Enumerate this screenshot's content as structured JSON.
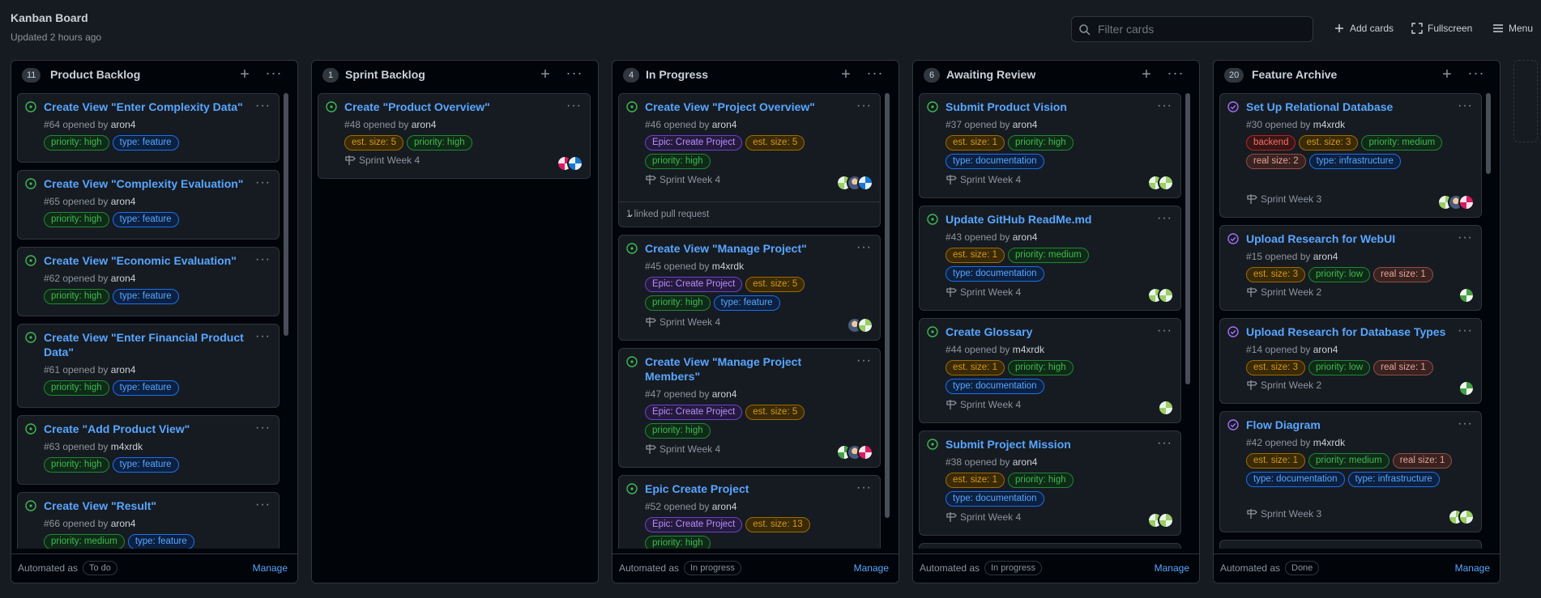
{
  "header": {
    "title": "Kanban Board",
    "updated": "Updated 2 hours ago",
    "filter_placeholder": "Filter cards",
    "add_cards": "Add cards",
    "fullscreen": "Fullscreen",
    "menu": "Menu"
  },
  "columns": [
    {
      "count": "11",
      "title": "Product Backlog",
      "auto_label": "Automated as",
      "auto_value": "To do",
      "manage": "Manage",
      "cards": [
        {
          "title": "Create View \"Enter Complexity Data\"",
          "meta_num": "#64 opened by",
          "meta_user": "aron4",
          "labels": [
            "priority: high",
            "type: feature"
          ]
        },
        {
          "title": "Create View \"Complexity Evaluation\"",
          "meta_num": "#65 opened by",
          "meta_user": "aron4",
          "labels": [
            "priority: high",
            "type: feature"
          ]
        },
        {
          "title": "Create View \"Economic Evaluation\"",
          "meta_num": "#62 opened by",
          "meta_user": "aron4",
          "labels": [
            "priority: high",
            "type: feature"
          ]
        },
        {
          "title": "Create View \"Enter Financial Product Data\"",
          "meta_num": "#61 opened by",
          "meta_user": "aron4",
          "labels": [
            "priority: high",
            "type: feature"
          ]
        },
        {
          "title": "Create \"Add Product View\"",
          "meta_num": "#63 opened by",
          "meta_user": "m4xrdk",
          "labels": [
            "priority: high",
            "type: feature"
          ]
        },
        {
          "title": "Create View \"Result\"",
          "meta_num": "#66 opened by",
          "meta_user": "aron4",
          "labels": [
            "priority: medium",
            "type: feature"
          ]
        }
      ]
    },
    {
      "count": "1",
      "title": "Sprint Backlog",
      "cards": [
        {
          "title": "Create \"Product Overview\"",
          "meta_num": "#48 opened by",
          "meta_user": "aron4",
          "labels": [
            "est. size: 5",
            "priority: high"
          ],
          "sprint": "Sprint Week 4"
        }
      ]
    },
    {
      "count": "4",
      "title": "In Progress",
      "auto_label": "Automated as",
      "auto_value": "In progress",
      "manage": "Manage",
      "cards": [
        {
          "title": "Create View \"Project Overview\"",
          "meta_num": "#46 opened by",
          "meta_user": "aron4",
          "labels": [
            "Epic: Create Project",
            "est. size: 5",
            "priority: high"
          ],
          "sprint": "Sprint Week 4",
          "linked": "1 linked pull request"
        },
        {
          "title": "Create View \"Manage Project\"",
          "meta_num": "#45 opened by",
          "meta_user": "m4xrdk",
          "labels": [
            "Epic: Create Project",
            "est. size: 5",
            "priority: high",
            "type: feature"
          ],
          "sprint": "Sprint Week 4"
        },
        {
          "title": "Create View \"Manage Project Members\"",
          "meta_num": "#47 opened by",
          "meta_user": "aron4",
          "labels": [
            "Epic: Create Project",
            "est. size: 5",
            "priority: high"
          ],
          "sprint": "Sprint Week 4"
        },
        {
          "title": "Epic Create Project",
          "meta_num": "#52 opened by",
          "meta_user": "aron4",
          "labels": [
            "Epic: Create Project",
            "est. size: 13",
            "priority: high"
          ]
        }
      ]
    },
    {
      "count": "6",
      "title": "Awaiting Review",
      "auto_label": "Automated as",
      "auto_value": "In progress",
      "manage": "Manage",
      "cards": [
        {
          "title": "Submit Product Vision",
          "meta_num": "#37 opened by",
          "meta_user": "aron4",
          "labels": [
            "est. size: 1",
            "priority: high",
            "type: documentation"
          ],
          "sprint": "Sprint Week 4"
        },
        {
          "title": "Update GitHub ReadMe.md",
          "meta_num": "#43 opened by",
          "meta_user": "aron4",
          "labels": [
            "est. size: 1",
            "priority: medium",
            "type: documentation"
          ],
          "sprint": "Sprint Week 4"
        },
        {
          "title": "Create Glossary",
          "meta_num": "#44 opened by",
          "meta_user": "m4xrdk",
          "labels": [
            "est. size: 1",
            "priority: high",
            "type: documentation"
          ],
          "sprint": "Sprint Week 4"
        },
        {
          "title": "Submit Project Mission",
          "meta_num": "#38 opened by",
          "meta_user": "aron4",
          "labels": [
            "est. size: 1",
            "priority: high",
            "type: documentation"
          ],
          "sprint": "Sprint Week 4"
        }
      ]
    },
    {
      "count": "20",
      "title": "Feature Archive",
      "auto_label": "Automated as",
      "auto_value": "Done",
      "manage": "Manage",
      "cards": [
        {
          "title": "Set Up Relational Database",
          "meta_num": "#30 opened by",
          "meta_user": "m4xrdk",
          "labels": [
            "backend",
            "est. size: 3",
            "priority: medium",
            "real size: 2",
            "type: infrastructure"
          ],
          "sprint": "Sprint Week 3"
        },
        {
          "title": "Upload Research for WebUI",
          "meta_num": "#15 opened by",
          "meta_user": "aron4",
          "labels": [
            "est. size: 3",
            "priority: low",
            "real size: 1"
          ],
          "sprint": "Sprint Week 2"
        },
        {
          "title": "Upload Research for Database Types",
          "meta_num": "#14 opened by",
          "meta_user": "aron4",
          "labels": [
            "est. size: 3",
            "priority: low",
            "real size: 1"
          ],
          "sprint": "Sprint Week 2"
        },
        {
          "title": "Flow Diagram",
          "meta_num": "#42 opened by",
          "meta_user": "m4xrdk",
          "labels": [
            "est. size: 1",
            "priority: medium",
            "real size: 1",
            "type: documentation",
            "type: infrastructure"
          ],
          "sprint": "Sprint Week 3"
        }
      ]
    }
  ]
}
